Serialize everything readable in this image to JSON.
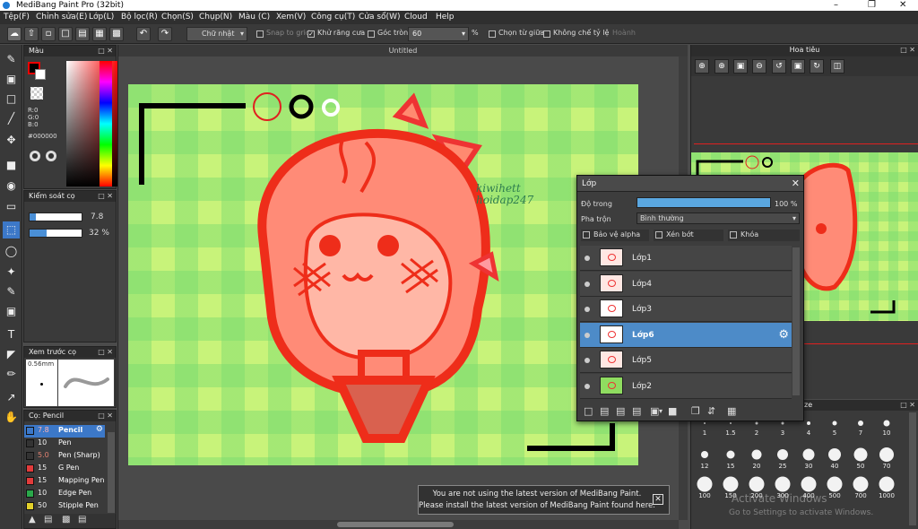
{
  "window": {
    "title": "MediBang Paint Pro (32bit)"
  },
  "menu": [
    "Tệp(F)",
    "Chỉnh sửa(E)",
    "Lớp(L)",
    "Bộ lọc(R)",
    "Chọn(S)",
    "Chụp(N)",
    "Màu (C)",
    "Xem(V)",
    "Công cụ(T)",
    "Cửa sổ(W)",
    "Cloud",
    "Help"
  ],
  "toolbar": {
    "select_mode": "Chữ nhật",
    "snap_label": "Snap to grid",
    "antialias_label": "Khử răng cưa",
    "antialias_checked": true,
    "round_label": "Góc tròn",
    "round_value": "60",
    "round_unit": "%",
    "from_center_label": "Chọn từ giữa",
    "keep_ratio_label": "Không chế tỷ lệ",
    "extra_label": "Hoành"
  },
  "color_panel": {
    "title": "Màu",
    "r": "R:0",
    "g": "G:0",
    "b": "B:0",
    "hex": "#000000"
  },
  "brush_control": {
    "title": "Kiểm soát cọ",
    "size_value": "7.8",
    "opacity_value": "32 %",
    "opacity_fraction": 0.32
  },
  "preview": {
    "title": "Xem trước cọ",
    "size_text": "0.56mm"
  },
  "brush_list": {
    "title": "Cọ: Pencil",
    "items": [
      {
        "size": "7.8",
        "name": "Pencil",
        "selected": true,
        "color": "#3c78c8"
      },
      {
        "size": "10",
        "name": "Pen",
        "selected": false,
        "color": "#333333"
      },
      {
        "size": "5.0",
        "name": "Pen (Sharp)",
        "selected": false,
        "color": "#333333"
      },
      {
        "size": "15",
        "name": "G Pen",
        "selected": false,
        "color": "#e23b3b"
      },
      {
        "size": "15",
        "name": "Mapping Pen",
        "selected": false,
        "color": "#e23b3b"
      },
      {
        "size": "10",
        "name": "Edge Pen",
        "selected": false,
        "color": "#2aa84a"
      },
      {
        "size": "50",
        "name": "Stipple Pen",
        "selected": false,
        "color": "#e2d02a"
      }
    ]
  },
  "canvas": {
    "tab_title": "Untitled",
    "signature_line1": "kiwihett",
    "signature_line2": "hoidap247"
  },
  "layers": {
    "title": "Lớp",
    "opacity_label": "Độ trong",
    "opacity_value": "100 %",
    "opacity_fraction": 1.0,
    "blend_label": "Pha trộn",
    "blend_value": "Bình thường",
    "protect_alpha_label": "Bảo vệ alpha",
    "clipping_label": "Xén bớt",
    "lock_label": "Khóa",
    "items": [
      {
        "name": "Lớp1",
        "selected": false
      },
      {
        "name": "Lớp4",
        "selected": false
      },
      {
        "name": "Lớp3",
        "selected": false
      },
      {
        "name": "Lớp6",
        "selected": true
      },
      {
        "name": "Lớp5",
        "selected": false
      },
      {
        "name": "Lớp2",
        "selected": false
      }
    ]
  },
  "toast": {
    "line1": "You are not using the latest version of MediBang Paint.",
    "line2": "Please install the latest version of MediBang Paint found here."
  },
  "navigator": {
    "title": "Hoa tiêu"
  },
  "brush_size_panel": {
    "title": "ze",
    "sizes": [
      "1",
      "1.5",
      "2",
      "3",
      "4",
      "5",
      "7",
      "10",
      "12",
      "15",
      "20",
      "25",
      "30",
      "40",
      "50",
      "70",
      "100",
      "150",
      "200",
      "300",
      "400",
      "500",
      "700",
      "1000"
    ]
  },
  "watermark": {
    "line1": "Activate Windows",
    "line2": "Go to Settings to activate Windows."
  }
}
